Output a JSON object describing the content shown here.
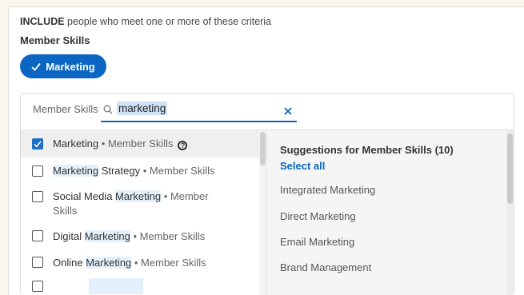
{
  "header": {
    "include_keyword": "INCLUDE",
    "include_rest": " people who meet one or more of these criteria",
    "section_title": "Member Skills"
  },
  "selected_pill": {
    "label": "Marketing",
    "color": "#0a66c2"
  },
  "search": {
    "label": "Member Skills",
    "value": "marketing",
    "clear": "×"
  },
  "results": [
    {
      "match": "Marketing",
      "name_rest": "",
      "type": " • Member Skills",
      "checked": true
    },
    {
      "match": "Marketing",
      "name_rest": " Strategy",
      "type": " • Member Skills",
      "checked": false
    },
    {
      "prefix": "Social Media ",
      "match": "Marketing",
      "type": " • Member",
      "type2": "Skills",
      "checked": false
    },
    {
      "prefix": "Digital ",
      "match": "Marketing",
      "type": " • Member Skills",
      "checked": false
    },
    {
      "prefix": "Online ",
      "match": "Marketing",
      "type": " • Member Skills",
      "checked": false
    }
  ],
  "suggestions": {
    "title": "Suggestions for Member Skills (10)",
    "select_all": "Select all",
    "items": [
      "Integrated Marketing",
      "Direct Marketing",
      "Email Marketing",
      "Brand Management"
    ]
  }
}
